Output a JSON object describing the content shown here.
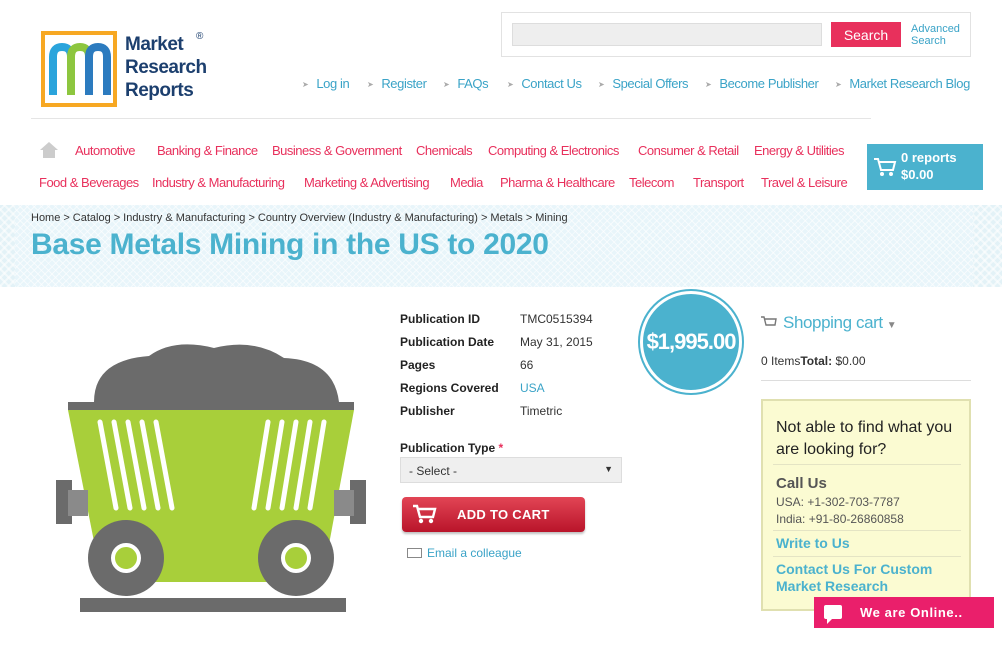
{
  "logo": {
    "line1": "Market",
    "line2": "Research",
    "line3": "Reports",
    "reg": "®"
  },
  "search": {
    "placeholder": "",
    "button": "Search",
    "advanced_line1": "Advanced",
    "advanced_line2": "Search"
  },
  "top_links": [
    "Log in",
    "Register",
    "FAQs",
    "Contact Us",
    "Special Offers",
    "Become Publisher",
    "Market Research Blog"
  ],
  "categories_row1": [
    "Automotive",
    "Banking & Finance",
    "Business & Government",
    "Chemicals",
    "Computing & Electronics",
    "Consumer & Retail",
    "Energy & Utilities"
  ],
  "categories_row2": [
    "Food & Beverages",
    "Industry & Manufacturing",
    "Marketing & Advertising",
    "Media",
    "Pharma & Healthcare",
    "Telecom",
    "Transport",
    "Travel & Leisure"
  ],
  "cart": {
    "reports": "0 reports",
    "total": "$0.00"
  },
  "breadcrumb": [
    "Home",
    "Catalog",
    "Industry & Manufacturing",
    "Country Overview (Industry & Manufacturing)",
    "Metals",
    "Mining"
  ],
  "title": "Base Metals Mining in the US to 2020",
  "details": [
    {
      "label": "Publication ID",
      "value": "TMC0515394"
    },
    {
      "label": "Publication Date",
      "value": "May 31, 2015"
    },
    {
      "label": "Pages",
      "value": "66"
    },
    {
      "label": "Regions Covered",
      "value": "USA"
    },
    {
      "label": "Publisher",
      "value": "Timetric"
    }
  ],
  "price": "$1,995.00",
  "publication_type": {
    "label": "Publication Type",
    "required": "*",
    "selected": "- Select -"
  },
  "add_to_cart": "ADD TO CART",
  "email_colleague": "Email a colleague",
  "shopping_cart": {
    "title": "Shopping cart",
    "items": "0 Items",
    "total_label": "Total:",
    "total_value": "$0.00"
  },
  "help": {
    "question": "Not able to find what you are looking for?",
    "call_us": "Call Us",
    "usa": "USA: +1-302-703-7787",
    "india": "India: +91-80-26860858",
    "write": "Write to Us",
    "custom": "Contact Us For Custom Market Research"
  },
  "chat": "We are Online..",
  "colors": {
    "accent": "#4bb2ce",
    "category": "#e8305c",
    "logo_frame": "#f7a823",
    "logo_text": "#1c3f6e",
    "chat": "#ea1f6b"
  }
}
